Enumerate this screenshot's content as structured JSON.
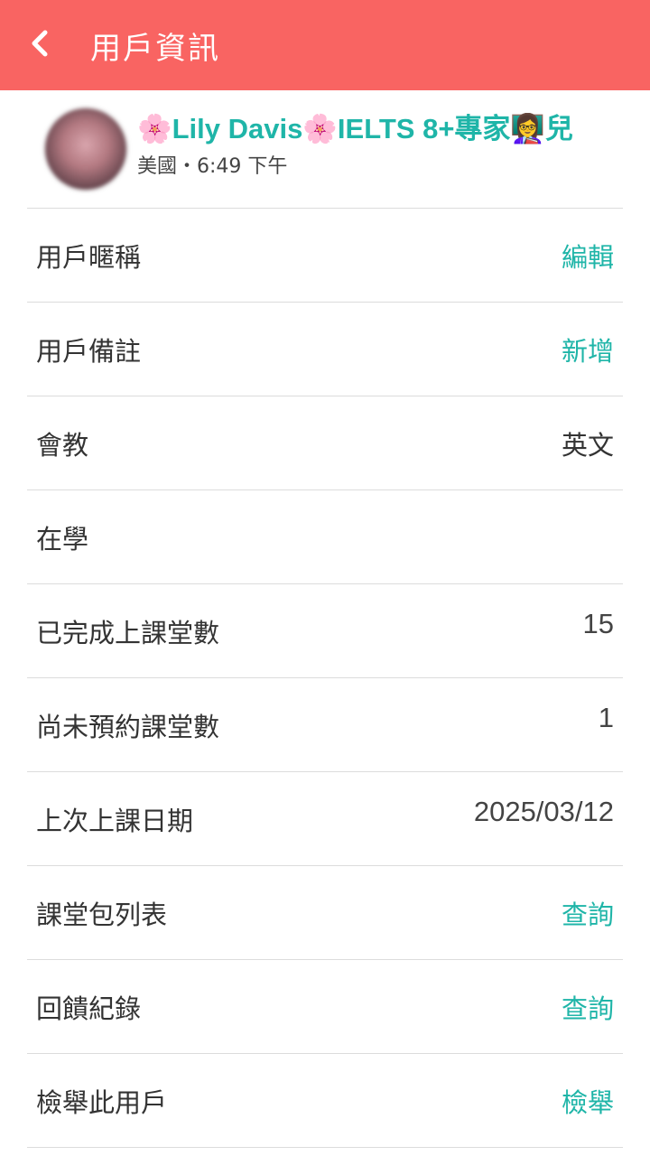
{
  "header": {
    "title": "用戶資訊",
    "back_icon": "chevron-left-icon",
    "background_color": "#f96462"
  },
  "profile": {
    "name": "🌸Lily Davis🌸IELTS 8+專家👩‍🏫兒",
    "location_time": "美國・6:49 下午",
    "name_color": "#1fb5a8"
  },
  "rows": [
    {
      "label": "用戶暱稱",
      "value": "編輯",
      "type": "action"
    },
    {
      "label": "用戶備註",
      "value": "新增",
      "type": "action"
    },
    {
      "label": "會教",
      "value": "英文",
      "type": "text"
    },
    {
      "label": "在學",
      "value": "",
      "type": "text"
    },
    {
      "label": "已完成上課堂數",
      "value": "15",
      "type": "numeric"
    },
    {
      "label": "尚未預約課堂數",
      "value": "1",
      "type": "numeric"
    },
    {
      "label": "上次上課日期",
      "value": "2025/03/12",
      "type": "numeric"
    },
    {
      "label": "課堂包列表",
      "value": "查詢",
      "type": "action"
    },
    {
      "label": "回饋紀錄",
      "value": "查詢",
      "type": "action"
    },
    {
      "label": "檢舉此用戶",
      "value": "檢舉",
      "type": "action"
    }
  ],
  "accent_color": "#1fb5a8"
}
